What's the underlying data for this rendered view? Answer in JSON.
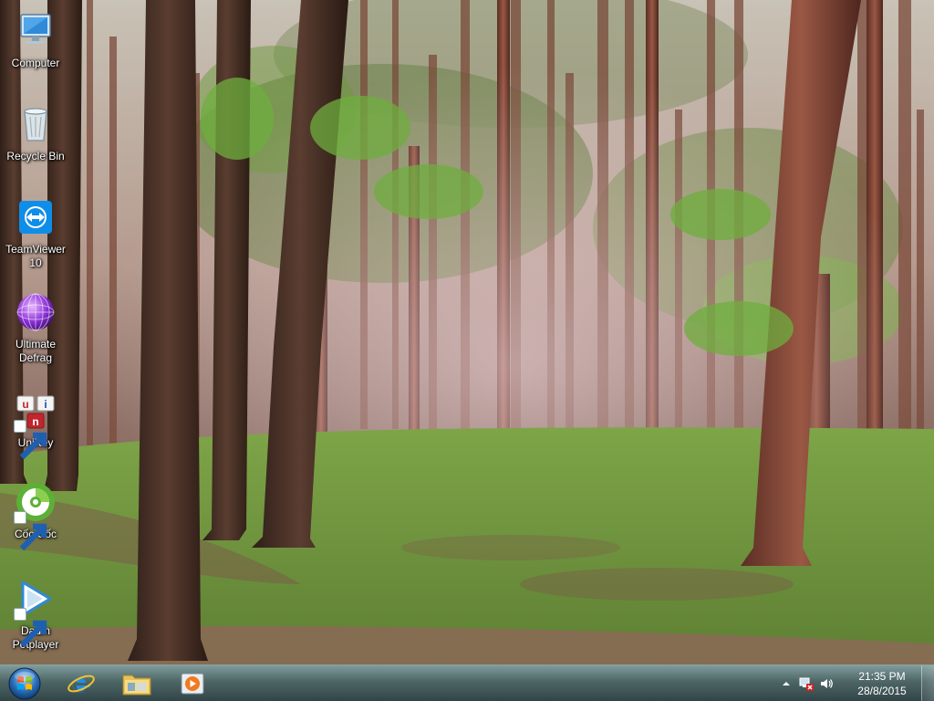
{
  "desktop": {
    "icons": [
      {
        "label": "Computer",
        "icon": "computer-icon"
      },
      {
        "label": "Recycle Bin",
        "icon": "recycle-bin-icon"
      },
      {
        "label": "TeamViewer\n10",
        "icon": "teamviewer-icon"
      },
      {
        "label": "Ultimate\nDefrag",
        "icon": "ultimate-defrag-icon"
      },
      {
        "label": "UniKey",
        "icon": "unikey-icon"
      },
      {
        "label": "Cốc Cốc",
        "icon": "coccoc-browser-icon"
      },
      {
        "label": "Daum\nPotplayer",
        "icon": "potplayer-icon"
      }
    ]
  },
  "taskbar": {
    "start_icon": "windows-start-orb-icon",
    "pinned": [
      {
        "icon": "internet-explorer-icon"
      },
      {
        "icon": "file-explorer-folder-icon"
      },
      {
        "icon": "media-player-icon"
      }
    ],
    "tray": {
      "icons": [
        "show-hidden-icons-arrow",
        "network-warning-icon",
        "volume-icon"
      ],
      "time": "21:35 PM",
      "date": "28/8/2015"
    }
  },
  "colors": {
    "taskbar": "#4a6466",
    "grass": "#6e9a3c",
    "path": "#8a6a55"
  }
}
